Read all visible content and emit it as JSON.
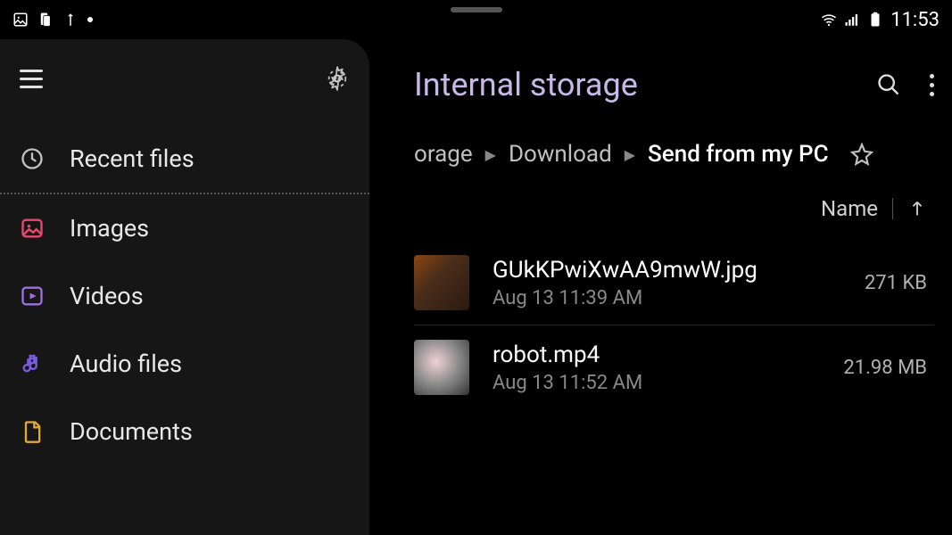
{
  "status_bar": {
    "time": "11:53"
  },
  "sidebar": {
    "items": [
      {
        "label": "Recent files",
        "icon": "clock-icon",
        "color": "#c0c0c0"
      },
      {
        "label": "Images",
        "icon": "image-icon",
        "color": "#e84a6f"
      },
      {
        "label": "Videos",
        "icon": "video-icon",
        "color": "#9d6fe0"
      },
      {
        "label": "Audio files",
        "icon": "audio-icon",
        "color": "#7b5be0"
      },
      {
        "label": "Documents",
        "icon": "document-icon",
        "color": "#e0a838"
      }
    ]
  },
  "content": {
    "title": "Internal storage",
    "breadcrumb": {
      "part1": "orage",
      "part2": "Download",
      "current": "Send from my PC"
    },
    "sort_label": "Name",
    "files": [
      {
        "name": "GUkKPwiXwAA9mwW.jpg",
        "date": "Aug 13 11:39 AM",
        "size": "271 KB"
      },
      {
        "name": "robot.mp4",
        "date": "Aug 13 11:52 AM",
        "size": "21.98 MB"
      }
    ]
  }
}
